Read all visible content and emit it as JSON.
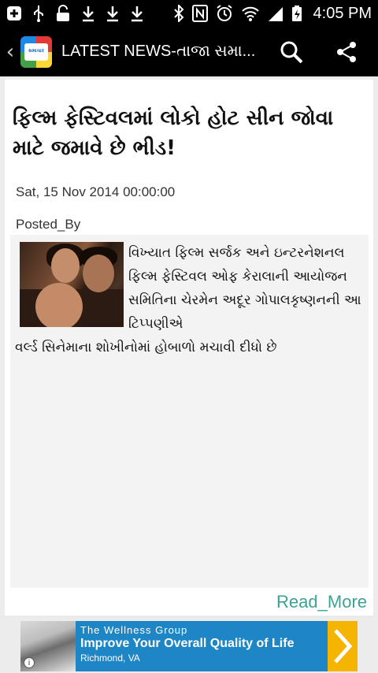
{
  "status_bar": {
    "time": "4:05 PM",
    "left_icons": [
      "add-icon",
      "usb-icon",
      "lock-icon",
      "download-icon",
      "download-icon",
      "download-icon"
    ],
    "right_icons": [
      "bluetooth-icon",
      "nfc-icon",
      "alarm-icon",
      "wifi-icon",
      "signal-icon",
      "battery-icon"
    ]
  },
  "app_bar": {
    "title": "LATEST NEWS-તાજા સમા...",
    "logo_text": "સમાચાર"
  },
  "article": {
    "headline": "ફિલ્મ ફેસ્ટિવલમાં લોકો હોટ સીન જોવા માટે જમાવે છે ભીડ!",
    "date": "Sat, 15 Nov 2014 00:00:00",
    "posted_by": "Posted_By",
    "body_first": "વિખ્યાત ફિલ્મ સર્જક અને ઇન્ટરનેશનલ ફિલ્મ ફેસ્ટિવલ ઓફ કેરાલાની આયોજન સમિતિના ચેરમેન અદૂર ગોપાલકૃષ્ણનની આ ટિપ્પણીએ",
    "body_rest": "વર્લ્ડ સિનેમાના શોખીનોમાં હોબાળો મચાવી દીધો છે",
    "read_more": "Read_More"
  },
  "ad": {
    "brand": "The Wellness Group",
    "headline": "Improve Your Overall Quality of Life",
    "location": "Richmond, VA",
    "info": "i"
  }
}
